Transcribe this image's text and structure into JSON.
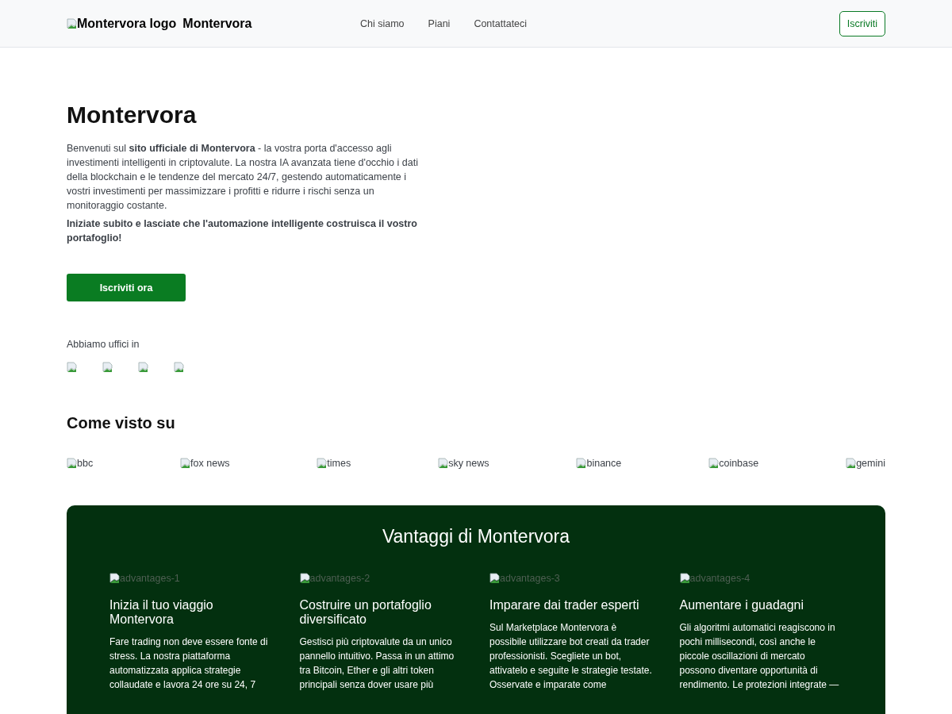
{
  "header": {
    "logo_alt": "Montervora logo",
    "brand": "Montervora",
    "nav": [
      {
        "label": "Chi siamo"
      },
      {
        "label": "Piani"
      },
      {
        "label": "Contattateci"
      }
    ],
    "signup": "Iscriviti"
  },
  "hero": {
    "title": "Montervora",
    "intro": "Benvenuti sul **sito ufficiale di Montervora** - la vostra porta d'accesso agli investimenti intelligenti in criptovalute. La nostra IA avanzata tiene d'occhio i dati della blockchain e le tendenze del mercato 24/7, gestendo automaticamente i vostri investimenti per massimizzare i profitti e ridurre i rischi senza un monitoraggio costante.",
    "cta_text": "Iniziate subito e lasciate che l'automazione intelligente costruisca il vostro portafoglio!",
    "button": "Iscriviti ora",
    "offices_label": "Abbiamo uffici in"
  },
  "press": {
    "title": "Come visto su",
    "logos": [
      "bbc",
      "fox news",
      "times",
      "sky news",
      "binance",
      "coinbase",
      "gemini"
    ]
  },
  "advantages": {
    "title": "Vantaggi di Montervora",
    "items": [
      {
        "image_alt": "advantages-1",
        "title": "Inizia il tuo viaggio Montervora",
        "text": "Fare trading non deve essere fonte di stress. La nostra piattaforma automatizzata applica strategie collaudate e lavora 24 ore su 24, 7"
      },
      {
        "image_alt": "advantages-2",
        "title": "Costruire un portafoglio diversificato",
        "text": "Gestisci più criptovalute da un unico pannello intuitivo. Passa in un attimo tra Bitcoin, Ether e gli altri token principali senza dover usare più"
      },
      {
        "image_alt": "advantages-3",
        "title": "Imparare dai trader esperti",
        "text": "Sul Marketplace Montervora è possibile utilizzare bot creati da trader professionisti. Scegliete un bot, attivatelo e seguite le strategie testate. Osservate e imparate come"
      },
      {
        "image_alt": "advantages-4",
        "title": "Aumentare i guadagni",
        "text": "Gli algoritmi automatici reagiscono in pochi millisecondi, così anche le piccole oscillazioni di mercato possono diventare opportunità di rendimento. Le protezioni integrate —"
      }
    ]
  }
}
